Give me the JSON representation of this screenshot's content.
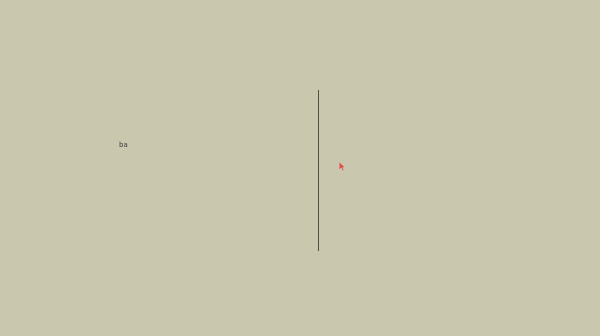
{
  "canvas": {
    "background_color": "#c9c7ae"
  },
  "small_label": {
    "text": "ba",
    "color": "#3b3b3b"
  },
  "divider": {
    "color": "#4f4f46"
  },
  "pointer": {
    "icon": "mouse-pointer-icon",
    "color": "#e34b4b"
  }
}
